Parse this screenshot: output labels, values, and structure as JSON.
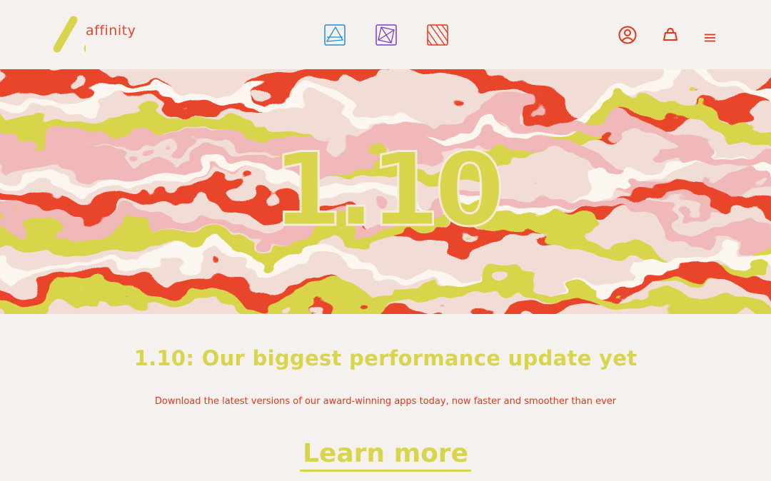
{
  "brand": {
    "name": "affinity"
  },
  "header": {
    "apps": [
      {
        "icon": "affinity-designer-icon",
        "color": "#1e8ed6"
      },
      {
        "icon": "affinity-photo-icon",
        "color": "#7a3fc8"
      },
      {
        "icon": "affinity-publisher-icon",
        "color": "#e8341c"
      }
    ],
    "account_icon": "account-icon",
    "cart_icon": "cart-icon",
    "menu_icon": "menu-icon"
  },
  "hero": {
    "version": "1.10"
  },
  "content": {
    "headline": "1.10: Our biggest performance update yet",
    "subline": "Download the latest versions of our award-winning apps today, now faster and smoother than ever",
    "cta": "Learn more"
  },
  "colors": {
    "background": "#f5f1ee",
    "accent_yellow": "#d8d54c",
    "accent_red": "#e8452c",
    "accent_pink": "#f0b8b8"
  }
}
